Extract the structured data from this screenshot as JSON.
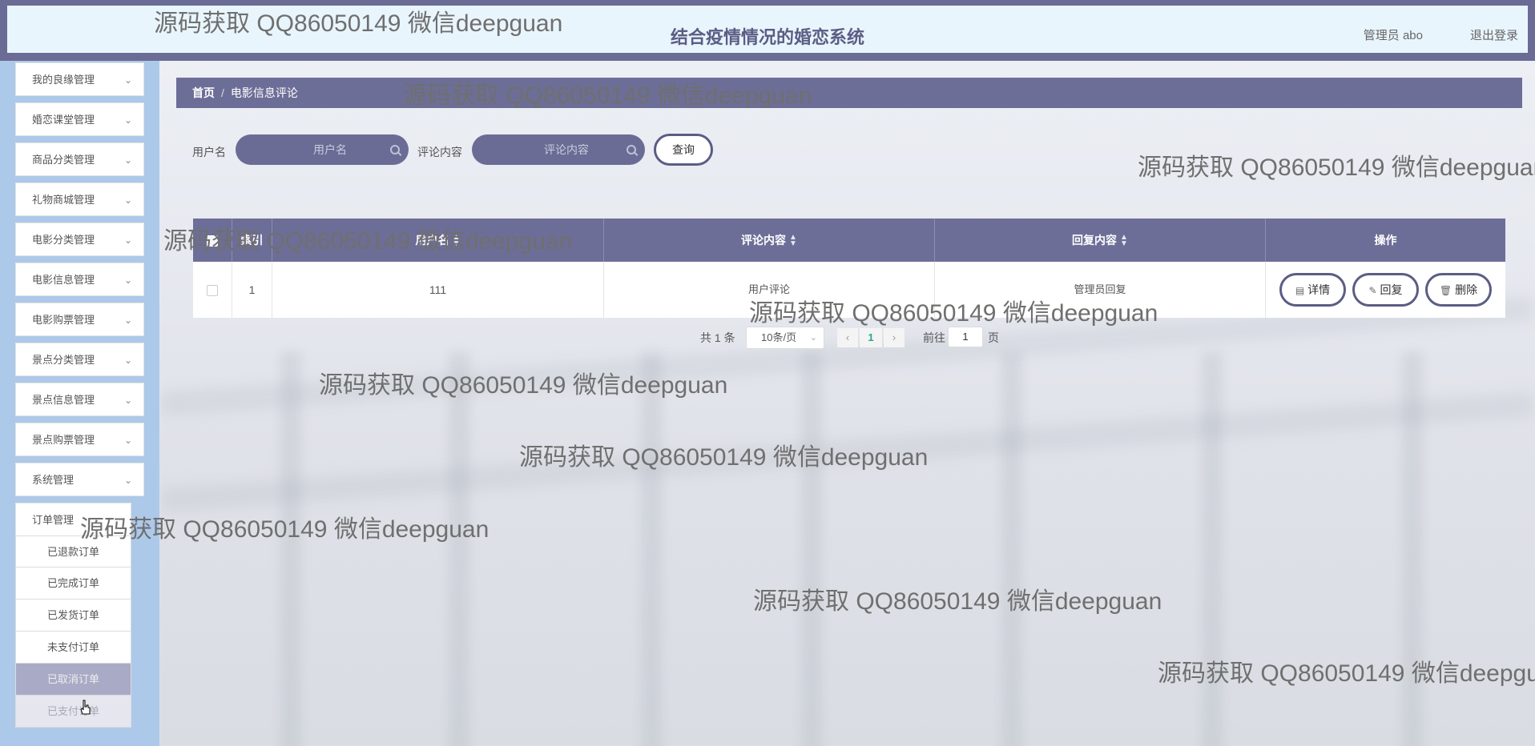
{
  "header": {
    "title": "结合疫情情况的婚恋系统",
    "admin_label": "管理员 abo",
    "logout_label": "退出登录"
  },
  "sidebar": {
    "items": [
      {
        "label": "我的良缘管理"
      },
      {
        "label": "婚恋课堂管理"
      },
      {
        "label": "商品分类管理"
      },
      {
        "label": "礼物商城管理"
      },
      {
        "label": "电影分类管理"
      },
      {
        "label": "电影信息管理"
      },
      {
        "label": "电影购票管理"
      },
      {
        "label": "景点分类管理"
      },
      {
        "label": "景点信息管理"
      },
      {
        "label": "景点购票管理"
      },
      {
        "label": "系统管理"
      },
      {
        "label": "订单管理"
      }
    ],
    "submenu": [
      {
        "label": "已退款订单"
      },
      {
        "label": "已完成订单"
      },
      {
        "label": "已发货订单"
      },
      {
        "label": "未支付订单"
      },
      {
        "label": "已取消订单"
      },
      {
        "label": "已支付订单"
      }
    ]
  },
  "breadcrumb": {
    "home": "首页",
    "separator": "/",
    "current": "电影信息评论"
  },
  "search": {
    "username_label": "用户名",
    "username_placeholder": "用户名",
    "comment_label": "评论内容",
    "comment_placeholder": "评论内容",
    "query_label": "查询"
  },
  "table": {
    "headers": {
      "index": "索引",
      "username": "用户名",
      "comment": "评论内容",
      "reply": "回复内容",
      "actions": "操作"
    },
    "rows": [
      {
        "index": "1",
        "username": "111",
        "comment": "用户评论",
        "reply": "管理员回复"
      }
    ],
    "actions": {
      "detail": "详情",
      "reply": "回复",
      "delete": "删除"
    }
  },
  "pagination": {
    "total": "共 1 条",
    "page_size": "10条/页",
    "current_page": "1",
    "goto_label": "前往",
    "goto_value": "1",
    "page_suffix": "页"
  },
  "watermark": "源码获取 QQ86050149 微信deepguan",
  "colors": {
    "primary": "#6d6e97",
    "header_bg": "#e9f5fd",
    "sidebar_bg": "#adc9e9",
    "active_page": "#2aa58f"
  }
}
